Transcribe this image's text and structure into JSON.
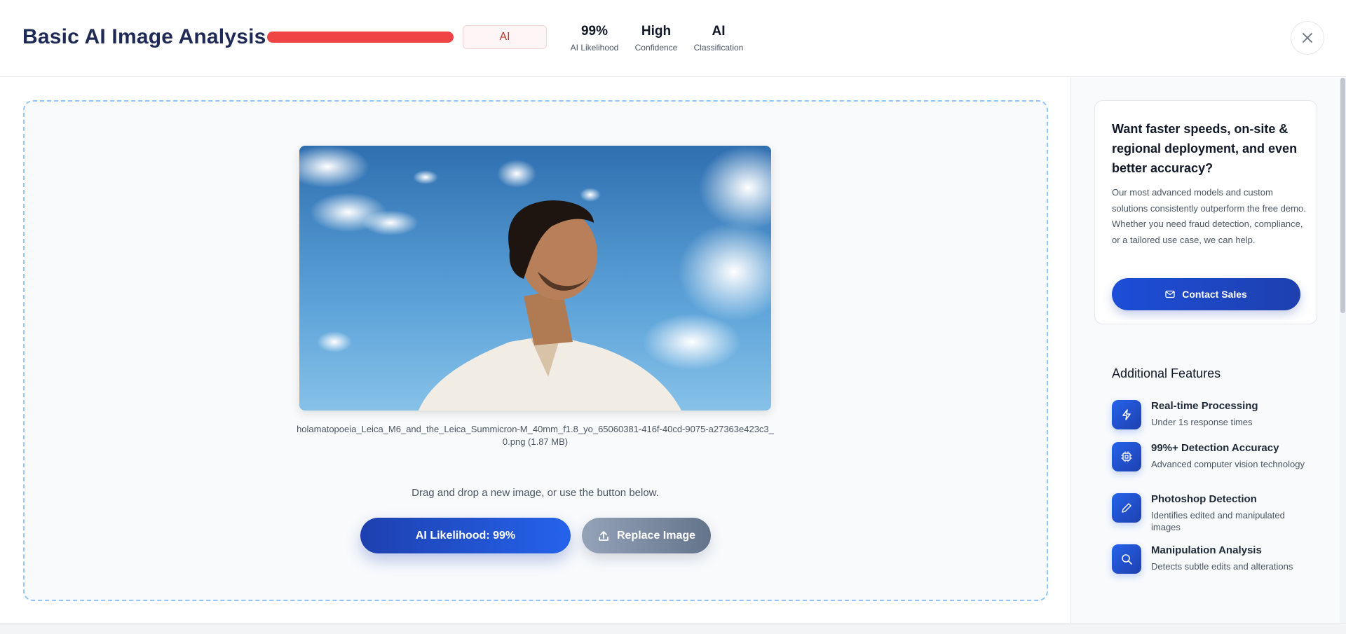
{
  "header": {
    "title": "Basic AI Image Analysis",
    "meter_level": 0.99,
    "meter_color": "#ef4444",
    "verdict": "AI",
    "stats": [
      {
        "value": "99%",
        "label": "AI Likelihood"
      },
      {
        "value": "High",
        "label": "Confidence"
      },
      {
        "value": "AI",
        "label": "Classification"
      }
    ],
    "close_icon": "close-icon"
  },
  "main": {
    "filename": "holamatopoeia_Leica_M6_and_the_Leica_Summicron-M_40mm_f1.8_yo_65060381-416f-40cd-9075-a27363e423c3_0.png (1.87 MB)",
    "hint": "Drag and drop a new image, or use the button below.",
    "likelihood_button": "AI Likelihood: 99%",
    "replace_button": "Replace Image",
    "replace_icon": "upload-icon"
  },
  "sidebar": {
    "promo": {
      "title": "Want faster speeds, on-site & regional deployment, and even better accuracy?",
      "body": "Our most advanced models and custom solutions consistently outperform the free demo. Whether you need fraud detection, compliance, or a tailored use case, we can help.",
      "button": "Contact Sales",
      "button_icon": "mail-icon"
    },
    "features_title": "Additional Features",
    "features": [
      {
        "icon": "lightning-icon",
        "title": "Real-time Processing",
        "desc": "Under 1s response times"
      },
      {
        "icon": "chip-icon",
        "title": "99%+ Detection Accuracy",
        "desc": "Advanced computer vision technology"
      },
      {
        "icon": "pencil-icon",
        "title": "Photoshop Detection",
        "desc": "Identifies edited and manipulated images"
      },
      {
        "icon": "search-icon",
        "title": "Manipulation Analysis",
        "desc": "Detects subtle edits and alterations"
      }
    ]
  },
  "colors": {
    "accent": "#1e40af",
    "danger": "#ef4444",
    "dropzone_border": "#93c5fd"
  }
}
